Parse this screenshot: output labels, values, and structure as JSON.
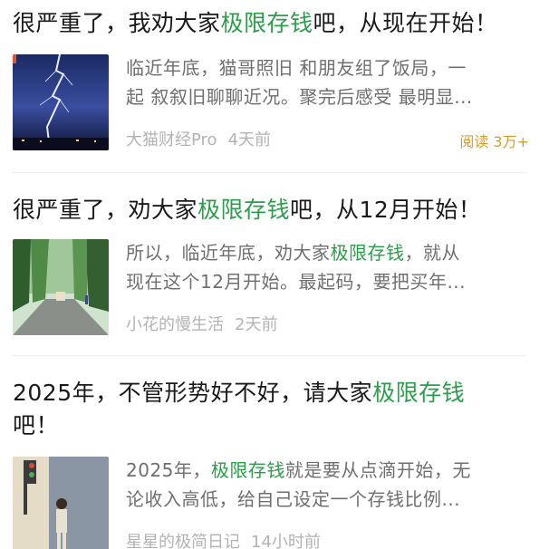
{
  "colors": {
    "highlight": "#2c9d4a",
    "title": "#1a1a1a",
    "excerpt": "#6f6f6f",
    "meta": "#b3b3b3",
    "reads": "#d99a28"
  },
  "articles": [
    {
      "title_pre": "很严重了，我劝大家",
      "title_hl": "极限存钱",
      "title_post": "吧，从现在开始！",
      "thumbnail": "lightning-storm-image",
      "excerpt_l1": "临近年底，猫哥照旧 和朋友组了饭局，一",
      "excerpt_l2": "起 叙叙旧聊聊近况。聚完后感受 最明显...",
      "author": "大猫财经Pro",
      "time": "4天前",
      "reads": "阅读 3万+"
    },
    {
      "title_pre": "很严重了，劝大家",
      "title_hl": "极限存钱",
      "title_post": "吧，从12月开始！",
      "thumbnail": "forest-road-image",
      "excerpt_l1_pre": "所以，临近年底，劝大家",
      "excerpt_l1_hl": "极限存钱",
      "excerpt_l1_post": "，就从",
      "excerpt_l2": "现在这个12月开始。最起码，要把买年...",
      "author": "小花的慢生活",
      "time": "2天前"
    },
    {
      "title_l1_pre": "2025年，不管形势好不好，请大家",
      "title_l1_hl": "极限存钱",
      "title_l2": "吧！",
      "thumbnail": "street-girl-illustration",
      "excerpt_l1_pre": "2025年，",
      "excerpt_l1_hl": "极限存钱",
      "excerpt_l1_post": "就是要从点滴开始，无",
      "excerpt_l2": "论收入高低，给自己设定一个存钱比例...",
      "author": "星星的极简日记",
      "time": "14小时前"
    }
  ]
}
